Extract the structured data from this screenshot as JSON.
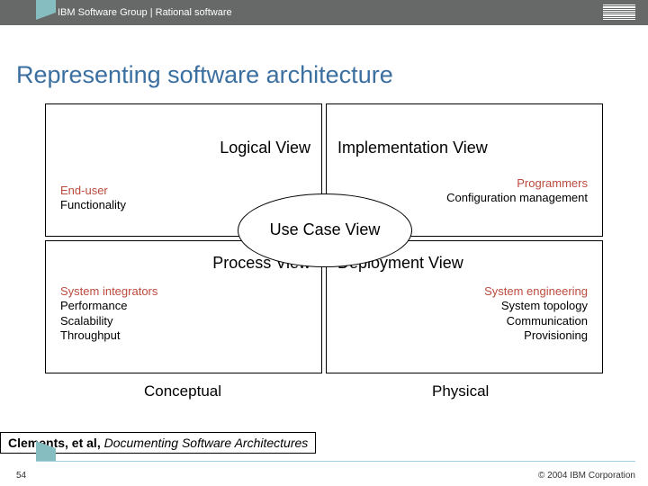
{
  "header": {
    "text": "IBM Software Group | Rational software",
    "logo_alt": "IBM"
  },
  "title": "Representing software architecture",
  "views": {
    "logical": {
      "title": "Logical View",
      "role": "End-user",
      "lines": [
        "Functionality"
      ]
    },
    "implementation": {
      "title": "Implementation View",
      "role": "Programmers",
      "lines": [
        "Configuration management"
      ]
    },
    "process": {
      "title": "Process View",
      "role": "System integrators",
      "lines": [
        "Performance",
        "Scalability",
        "Throughput"
      ]
    },
    "deployment": {
      "title": "Deployment View",
      "role": "System engineering",
      "lines": [
        "System topology",
        "Communication",
        "Provisioning"
      ]
    },
    "center": "Use Case View"
  },
  "axis": {
    "left": "Conceptual",
    "right": "Physical"
  },
  "citation": {
    "authors": "Clements, et al,",
    "title": "Documenting Software Architectures"
  },
  "footer": {
    "page": "54",
    "copyright": "© 2004 IBM Corporation"
  }
}
